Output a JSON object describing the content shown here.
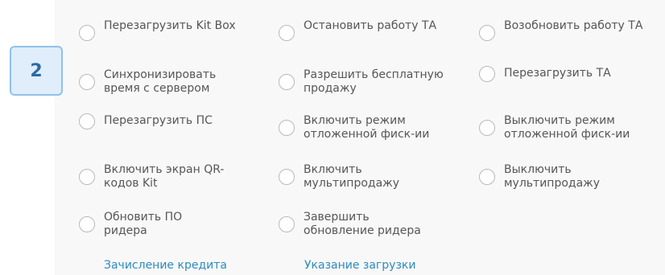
{
  "options": {
    "reboot_kit_box": "Перезагрузить Kit Box",
    "stop_ta": "Остановить работу ТА",
    "resume_ta": "Возобновить работу ТА",
    "sync_time": "Синхронизировать время с сервером",
    "allow_free_sale": "Разрешить бесплатную продажу",
    "reboot_ta": "Перезагрузить ТА",
    "reboot_ps": "Перезагрузить ПС",
    "enable_deferred_fiscal": "Включить режим отложенной фиск-ии",
    "disable_deferred_fiscal": "Выключить режим отложенной фиск-ии",
    "enable_qr_screen": "Включить экран QR-кодов Kit",
    "enable_multisale": "Включить мультипродажу",
    "disable_multisale": "Выключить мультипродажу",
    "update_reader_fw": "Обновить ПО ридера",
    "finish_reader_update": "Завершить обновление ридера"
  },
  "links": {
    "credit": "Зачисление кредита",
    "load": "Указание загрузки"
  },
  "badge": {
    "number": "2"
  }
}
